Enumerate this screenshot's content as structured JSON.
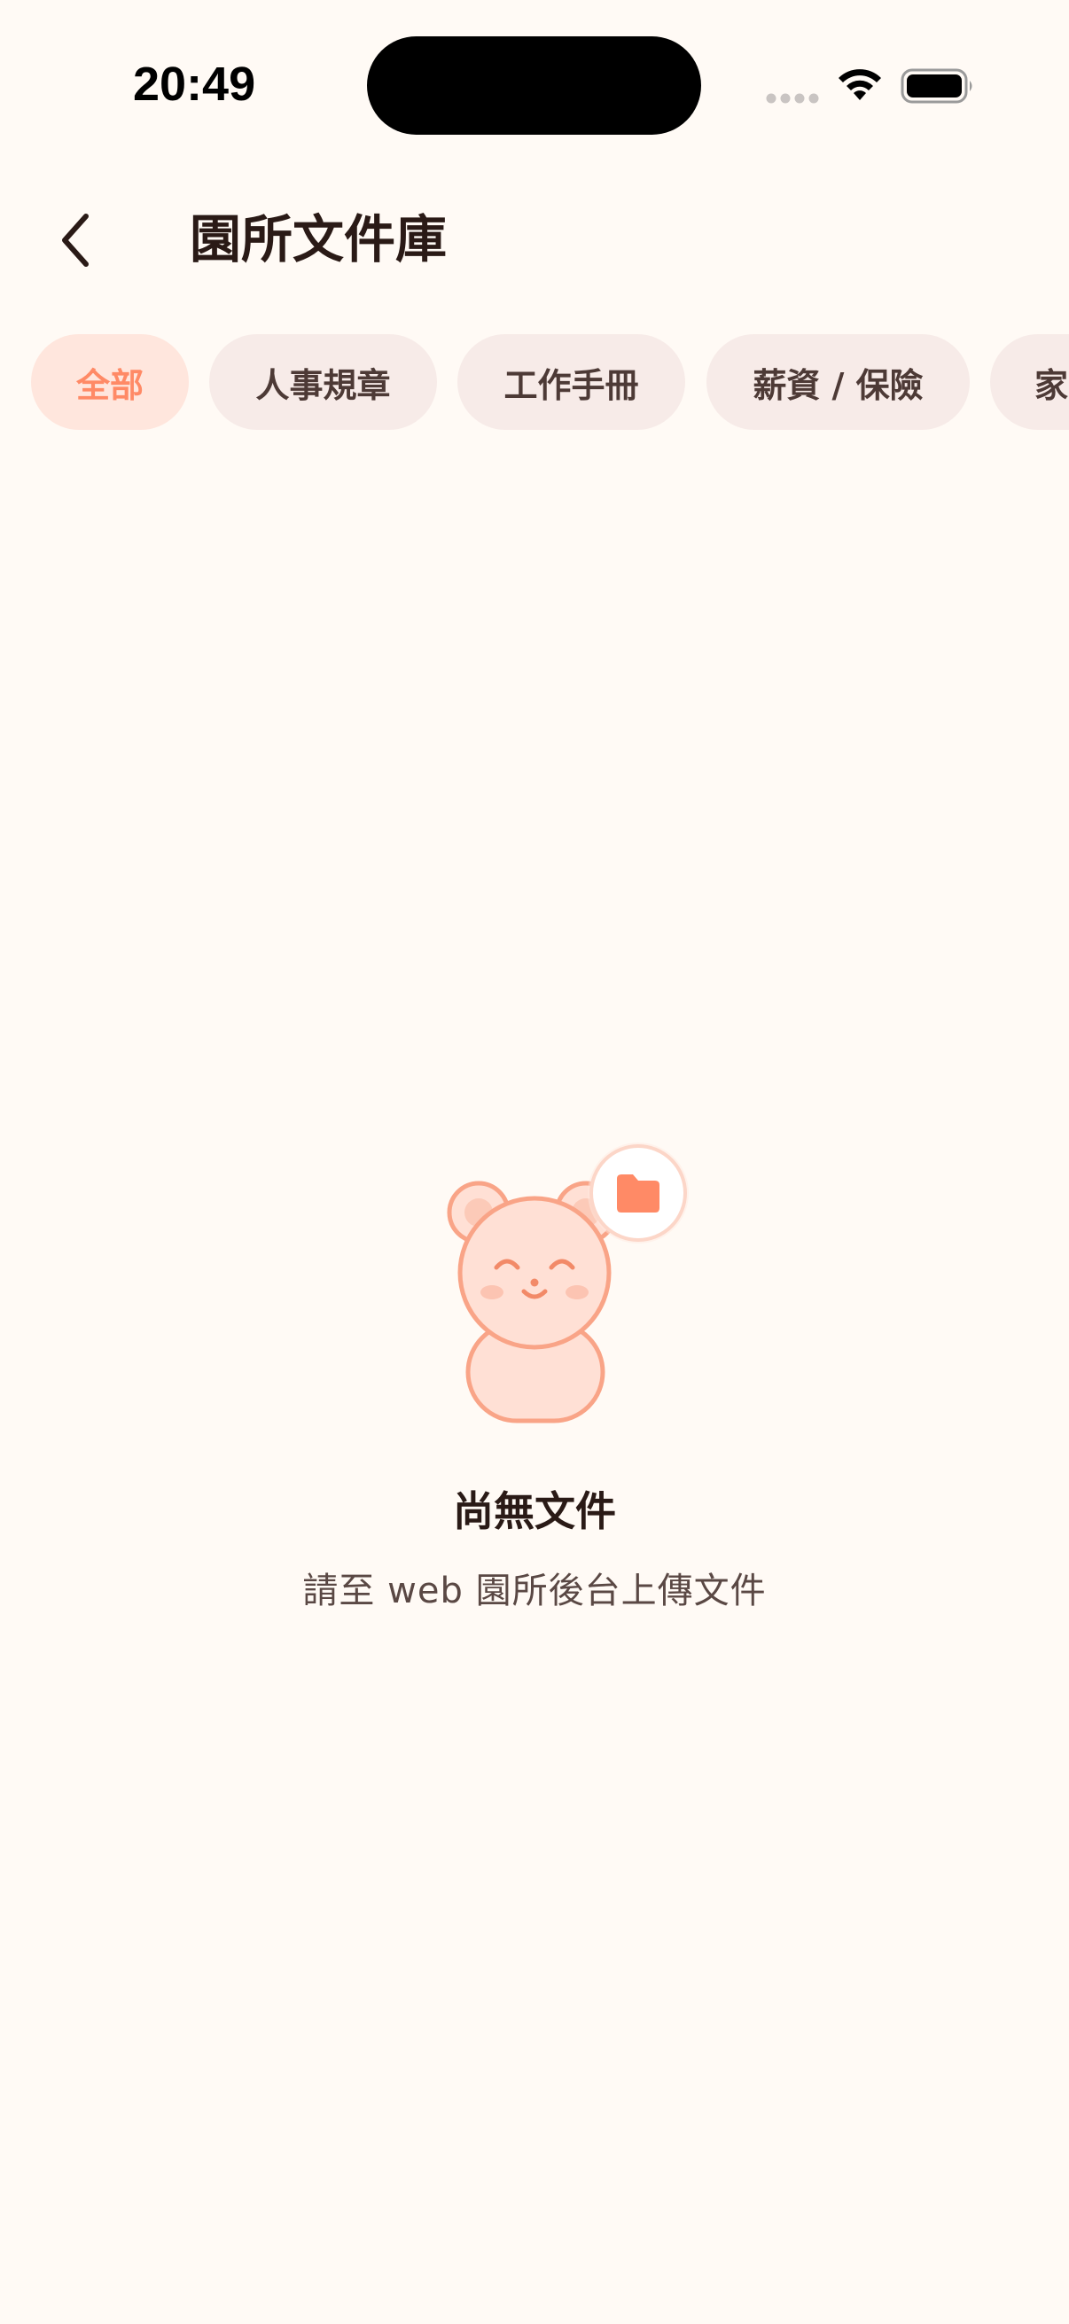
{
  "status_bar": {
    "time": "20:49",
    "icons": [
      "signal-dots-icon",
      "wifi-icon",
      "battery-icon"
    ]
  },
  "header": {
    "back_icon": "chevron-left-icon",
    "title": "園所文件庫"
  },
  "categories": {
    "selected": "全部",
    "items": [
      {
        "label": "全部",
        "active": true
      },
      {
        "label": "人事規章",
        "active": false
      },
      {
        "label": "工作手冊",
        "active": false
      },
      {
        "label": "薪資 / 保險",
        "active": false
      },
      {
        "label": "家",
        "active": false
      }
    ]
  },
  "empty_state": {
    "illustration": "bear-with-folder-icon",
    "title": "尚無文件",
    "subtitle": "請至 web 園所後台上傳文件"
  },
  "colors": {
    "background": "#FFFAF5",
    "accent": "#FF8A66",
    "chip_active_bg": "#FFE6DD",
    "chip_bg": "#F7EBE8",
    "title_text": "#2A1A16",
    "body_text": "#5A4844"
  }
}
